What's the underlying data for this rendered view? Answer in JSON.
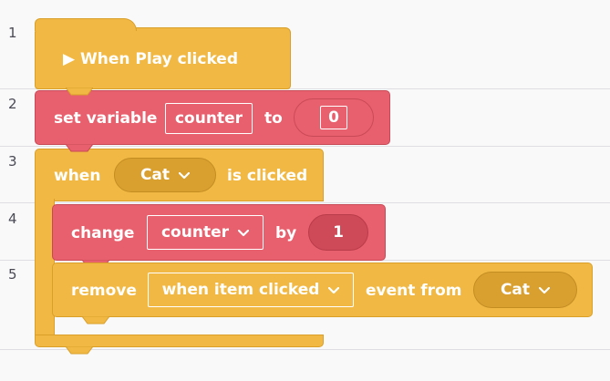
{
  "line_numbers": [
    "1",
    "2",
    "3",
    "4",
    "5"
  ],
  "blocks": {
    "event": {
      "label": "▶ When Play clicked",
      "color": "#f1b944"
    },
    "set_variable": {
      "label": "set variable",
      "variable": "counter",
      "to_label": "to",
      "value": "0",
      "color": "#e8606d"
    },
    "when_clicked": {
      "when_label": "when",
      "target": "Cat",
      "is_clicked_label": "is clicked",
      "color": "#f1b944"
    },
    "change": {
      "label": "change",
      "variable": "counter",
      "by_label": "by",
      "value": "1",
      "color": "#e8606d"
    },
    "remove": {
      "label": "remove",
      "event": "when item clicked",
      "event_from_label": "event from",
      "target": "Cat",
      "color": "#f1b944"
    }
  },
  "icons": {
    "dropdown": "chevron-down-icon"
  }
}
